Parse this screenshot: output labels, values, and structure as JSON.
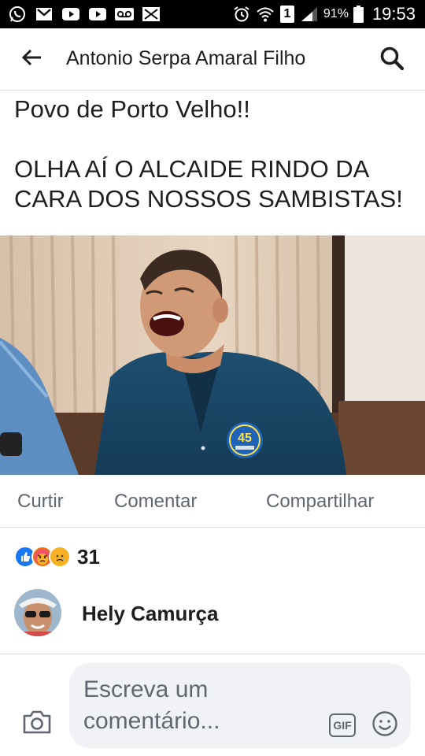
{
  "status_bar": {
    "icons": [
      "whatsapp-icon",
      "gmail-icon",
      "youtube-icon",
      "youtube-icon",
      "voicemail-icon",
      "missed-call-icon",
      "alarm-icon",
      "wifi-icon",
      "sim-1-icon",
      "signal-icon",
      "battery-icon"
    ],
    "sim_label": "1",
    "battery_percent": "91%",
    "time": "19:53"
  },
  "header": {
    "back_icon": "arrow-left-icon",
    "title": "Antonio Serpa Amaral Filho",
    "search_icon": "search-icon"
  },
  "post": {
    "text_lines": [
      "Povo de Porto Velho!!",
      "",
      "OLHA AÍ O ALCAIDE RINDO DA",
      "CARA DOS NOSSOS SAMBISTAS!"
    ],
    "photo": {
      "badge_number": "45"
    }
  },
  "actions": {
    "like": "Curtir",
    "comment": "Comentar",
    "share": "Compartilhar"
  },
  "reactions": {
    "types": [
      "like",
      "angry",
      "sad"
    ],
    "count": "31"
  },
  "commenter": {
    "name": "Hely Camurça"
  },
  "composer": {
    "placeholder": "Escreva um comentário...",
    "gif_label": "GIF",
    "camera_icon": "camera-icon",
    "emoji_icon": "emoji-icon"
  }
}
